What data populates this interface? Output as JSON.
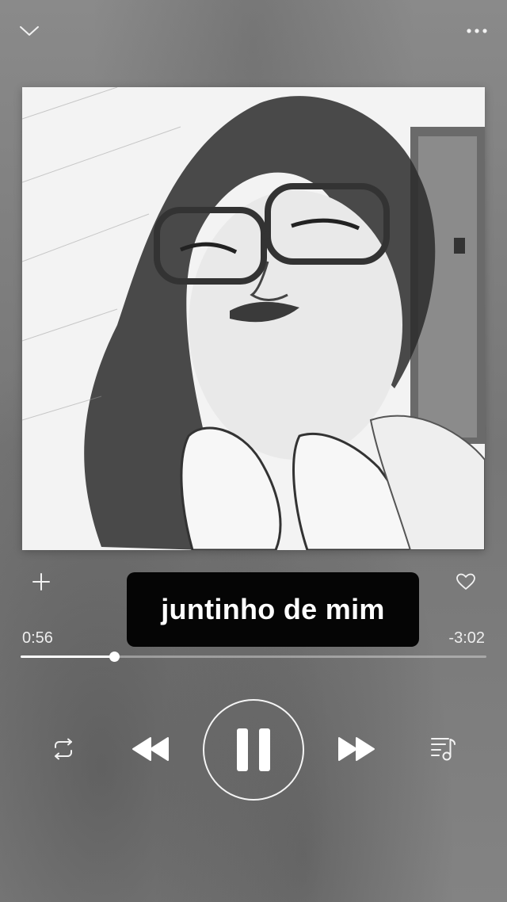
{
  "player": {
    "track_title": "juntinho de mim",
    "elapsed": "0:56",
    "remaining": "-3:02",
    "progress_fraction": 0.2,
    "state": "playing"
  },
  "icons": {
    "collapse": "chevron-down-icon",
    "more": "more-horizontal-icon",
    "add": "plus-icon",
    "favorite": "heart-outline-icon",
    "repeat": "repeat-icon",
    "previous": "rewind-icon",
    "play_pause": "pause-icon",
    "next": "fast-forward-icon",
    "queue": "playlist-icon"
  },
  "colors": {
    "background": "#7d7d7d",
    "title_box": "#050505",
    "foreground": "#ffffff"
  }
}
